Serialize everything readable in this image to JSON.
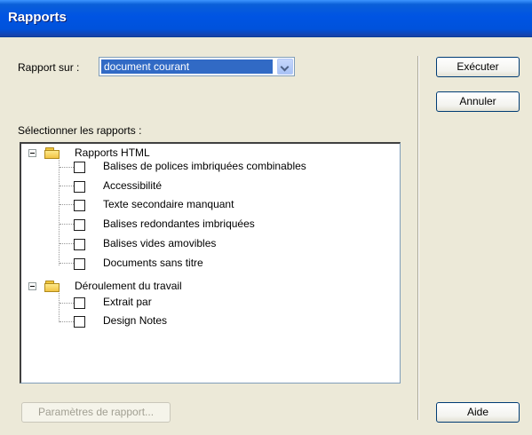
{
  "window": {
    "title": "Rapports"
  },
  "report_on": {
    "label": "Rapport sur :",
    "selected": "document courant"
  },
  "select_reports": {
    "label": "Sélectionner les rapports :"
  },
  "buttons": {
    "run": "Exécuter",
    "cancel": "Annuler",
    "settings": "Paramètres de rapport...",
    "help": "Aide"
  },
  "tree": {
    "groups": [
      {
        "label": "Rapports HTML",
        "expanded": true,
        "items": [
          {
            "label": "Balises de polices imbriquées combinables",
            "checked": false
          },
          {
            "label": "Accessibilité",
            "checked": false
          },
          {
            "label": "Texte secondaire manquant",
            "checked": false
          },
          {
            "label": "Balises redondantes imbriquées",
            "checked": false
          },
          {
            "label": "Balises vides amovibles",
            "checked": false
          },
          {
            "label": "Documents sans titre",
            "checked": false
          }
        ]
      },
      {
        "label": "Déroulement du travail",
        "expanded": true,
        "items": [
          {
            "label": "Extrait par",
            "checked": false
          },
          {
            "label": "Design Notes",
            "checked": false
          }
        ]
      }
    ]
  },
  "icons": {
    "expander": "minus-expander-icon",
    "folder": "folder-icon",
    "dropdown": "chevron-down-icon"
  }
}
